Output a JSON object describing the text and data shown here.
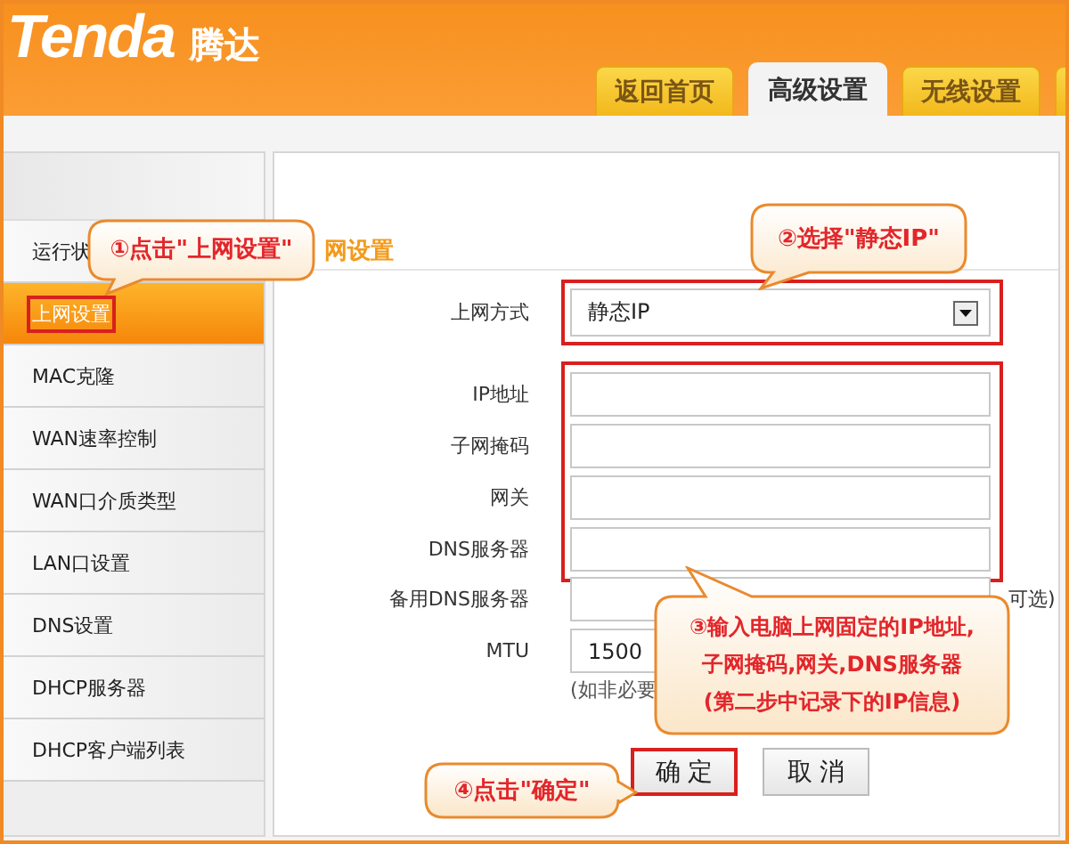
{
  "header": {
    "logo": "Tenda",
    "brand": "腾达"
  },
  "tabs": [
    {
      "label": "返回首页",
      "selected": false
    },
    {
      "label": "高级设置",
      "selected": true
    },
    {
      "label": "无线设置",
      "selected": false
    }
  ],
  "sidebar": {
    "items": [
      {
        "label": "运行状",
        "selected": false,
        "highlight": false
      },
      {
        "label": "上网设置",
        "selected": true,
        "highlight": true
      },
      {
        "label": "MAC克隆",
        "selected": false,
        "highlight": false
      },
      {
        "label": "WAN速率控制",
        "selected": false,
        "highlight": false
      },
      {
        "label": "WAN口介质类型",
        "selected": false,
        "highlight": false
      },
      {
        "label": "LAN口设置",
        "selected": false,
        "highlight": false
      },
      {
        "label": "DNS设置",
        "selected": false,
        "highlight": false
      },
      {
        "label": "DHCP服务器",
        "selected": false,
        "highlight": false
      },
      {
        "label": "DHCP客户端列表",
        "selected": false,
        "highlight": false
      }
    ]
  },
  "panel": {
    "title": "网设置",
    "groups": [
      {
        "highlight": true,
        "fields": [
          {
            "label": "上网方式",
            "kind": "select",
            "value": "静态IP"
          }
        ]
      },
      {
        "highlight": true,
        "fields": [
          {
            "label": "IP地址",
            "kind": "input"
          },
          {
            "label": "子网掩码",
            "kind": "input"
          },
          {
            "label": "网关",
            "kind": "input"
          },
          {
            "label": "DNS服务器",
            "kind": "input"
          }
        ]
      },
      {
        "highlight": false,
        "fields": [
          {
            "label": "备用DNS服务器",
            "kind": "input",
            "suffix": "可选)"
          },
          {
            "label": "MTU",
            "kind": "input",
            "value": "1500",
            "note": "(如非必要"
          }
        ]
      }
    ],
    "buttons": [
      {
        "label": "确 定",
        "highlight": true
      },
      {
        "label": "取 消",
        "highlight": false
      }
    ]
  },
  "callouts": [
    {
      "lines": [
        "①点击\"上网设置\""
      ]
    },
    {
      "lines": [
        "②选择\"静态IP\""
      ]
    },
    {
      "lines": [
        "③输入电脑上网固定的IP地址,",
        "子网掩码,网关,DNS服务器",
        "(第二步中记录下的IP信息)"
      ]
    },
    {
      "lines": [
        "④点击\"确定\""
      ]
    }
  ]
}
